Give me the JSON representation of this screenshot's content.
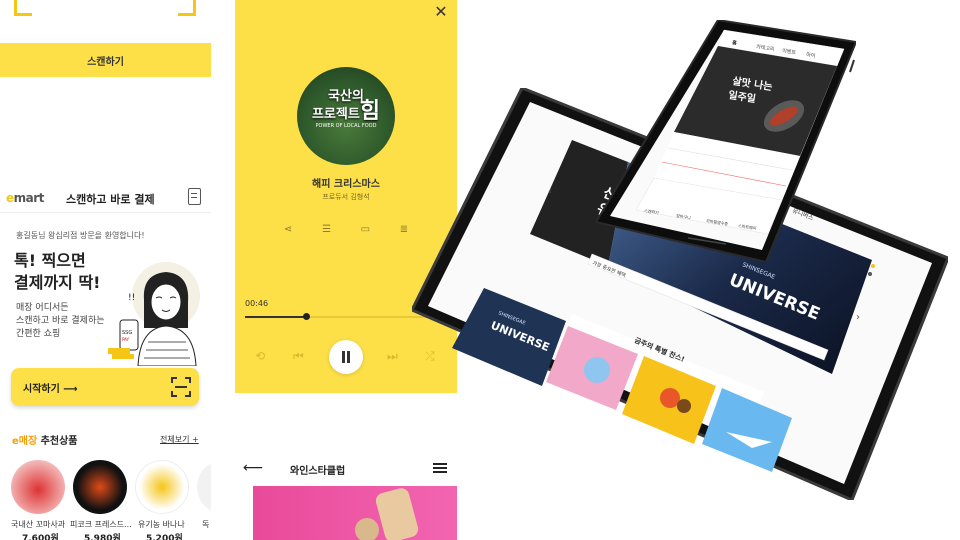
{
  "emart": {
    "scan_button": "스캔하기",
    "logo_e": "e",
    "logo_rest": "mart",
    "title": "스캔하고 바로 결제",
    "welcome": "홍길동님 왕십리점 방문을 환영합니다!",
    "headline_line1": "톡! 찍으면",
    "headline_line2": "결제까지 딱!",
    "sub_line1": "매장 어디서든",
    "sub_line2": "스캔하고 바로 결제하는",
    "sub_line3": "간편한 쇼핑",
    "start_button": "시작하기 ⟶",
    "reco_prefix": "e매장",
    "reco_title": " 추천상품",
    "see_all": "전체보기 +",
    "products": [
      {
        "name": "국내산 꼬마사과",
        "price": "7,600원"
      },
      {
        "name": "피코크 프레스드...",
        "price": "5,980원"
      },
      {
        "name": "유기농 바나나",
        "price": "5,200원"
      },
      {
        "name": "독",
        "price": ""
      }
    ]
  },
  "player": {
    "album_line1": "국산의",
    "album_line2": "프로젝트",
    "album_big": "힘",
    "album_sub": "POWER OF LOCAL FOOD",
    "song_title": "해피 크리스마스",
    "artist": "프로듀서 김형석",
    "elapsed": "00:46",
    "progress": 0.29
  },
  "wine": {
    "title": "와인스타클럽"
  },
  "tablet": {
    "hero_line1": "신세",
    "hero_line2": "유니",
    "universe_top": "SHINSEGAE",
    "universe_big": "UNIVERSE",
    "side_label": "유니버스",
    "tab_active": "가장 중요한 혜택",
    "thumb_top": "SHINSEGAE",
    "thumb_big": "UNIVERSE",
    "event_title": "금주의 특별 찬스!"
  },
  "phone": {
    "hero_title_1": "살맛 나는",
    "hero_title_2": "일주일",
    "nav": [
      "홈",
      "카테고리",
      "이벤트",
      "마이"
    ],
    "bottom_tabs": [
      "스캔하기",
      "장바구니",
      "모바일영수증",
      "스마트페이"
    ]
  },
  "colors": {
    "accent_yellow": "#fde047",
    "emart_yellow": "#f5c518",
    "wine_pink": "#ec4899"
  }
}
